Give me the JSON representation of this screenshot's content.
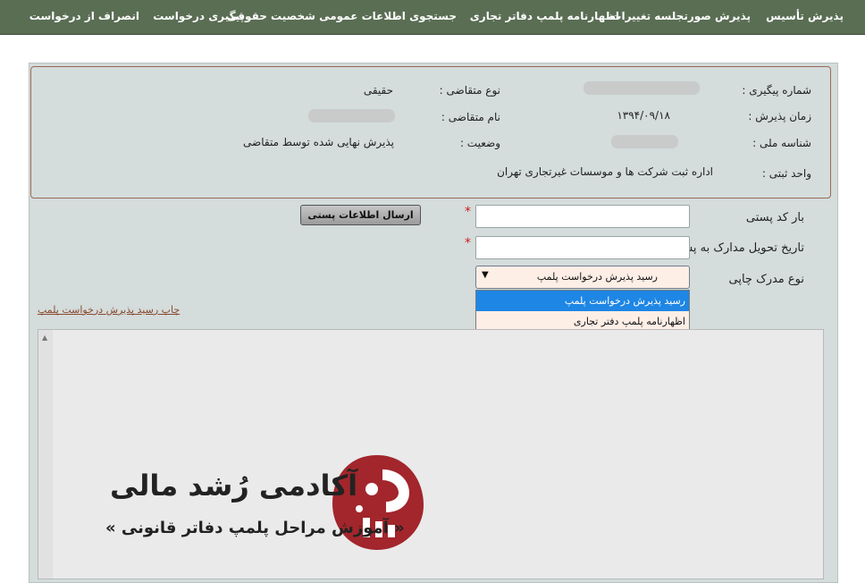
{
  "nav": {
    "items": [
      "پذیرش تأسیس",
      "پذیرش صورتجلسه تغییرات",
      "اظهارنامه پلمپ دفاتر تجاری",
      "جستجوی اطلاعات عمومی شخصیت حقوقی",
      "پیگیری درخواست",
      "انصراف از درخواست"
    ]
  },
  "info": {
    "tracking_label": "شماره پیگیری :",
    "applicant_type_label": "نوع متقاضی :",
    "applicant_type_value": "حقیقی",
    "accept_time_label": "زمان پذیرش :",
    "accept_time_value": "۱۳۹۴/۰۹/۱۸",
    "applicant_name_label": "نام متقاضی :",
    "national_id_label": "شناسه ملی :",
    "status_label": "وضعیت :",
    "status_value": "پذیرش نهایی شده توسط متقاضی",
    "reg_unit_label": "واحد ثبتی :",
    "reg_unit_value": "اداره ثبت شرکت ها و موسسات غیرتجاری تهران"
  },
  "form": {
    "barcode_label": "بار کد پستی",
    "delivery_date_label": "تاریخ تحویل مدارک به پست",
    "doc_type_label": "نوع مدرک چاپی",
    "required_mark": "*",
    "send_button": "ارسال اطلاعات پستی",
    "doc_type_selected": "رسید پذیرش درخواست پلمپ",
    "doc_type_options": [
      "رسید پذیرش درخواست پلمپ",
      "اظهارنامه پلمپ دفتر تجاری"
    ],
    "print_link": "چاپ رسید پذیرش درخواست پلمپ"
  },
  "watermark": {
    "title": "آکادمی رُشد مالی",
    "subtitle": "« آموزش مراحل پلمپ دفاتر قانونی »"
  },
  "colors": {
    "nav_bg": "#5a6e54",
    "panel_bg": "#d4dcdc",
    "accent_blue": "#1e86e4",
    "logo_red": "#a2262c",
    "required_red": "#d21b1b"
  },
  "icons": {
    "dropdown_arrow": "▼",
    "scroll_up": "▲"
  }
}
